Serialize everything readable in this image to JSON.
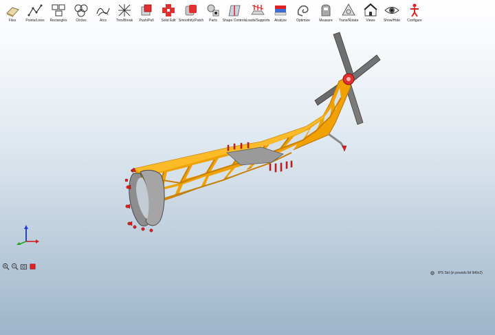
{
  "toolbar": {
    "items": [
      {
        "label": "Files",
        "icon": "files-icon"
      },
      {
        "label": "Points/Lines",
        "icon": "points-lines-icon"
      },
      {
        "label": "Rectangles",
        "icon": "rectangles-icon"
      },
      {
        "label": "Circles",
        "icon": "circles-icon"
      },
      {
        "label": "Arcs",
        "icon": "arcs-icon"
      },
      {
        "label": "Trim/Break",
        "icon": "trim-break-icon"
      },
      {
        "label": "Push/Pull",
        "icon": "push-pull-icon"
      },
      {
        "label": "Solid Edit",
        "icon": "solid-edit-icon"
      },
      {
        "label": "Smoothify/Patch",
        "icon": "smoothify-patch-icon"
      },
      {
        "label": "Parts",
        "icon": "parts-icon"
      },
      {
        "label": "Shape Controls",
        "icon": "shape-controls-icon"
      },
      {
        "label": "Loads/Supports",
        "icon": "loads-supports-icon"
      },
      {
        "label": "Analyze",
        "icon": "analyze-icon"
      },
      {
        "label": "Optimize",
        "icon": "optimize-icon"
      },
      {
        "label": "Measure",
        "icon": "measure-icon"
      },
      {
        "label": "Trans/Rotate",
        "icon": "trans-rotate-icon"
      },
      {
        "label": "Views",
        "icon": "views-icon"
      },
      {
        "label": "Show/Hide",
        "icon": "show-hide-icon"
      },
      {
        "label": "Configure",
        "icon": "configure-icon"
      }
    ]
  },
  "status": {
    "units": "IPS Std (in pounds lbf lbf/in2)"
  },
  "navigation": {
    "icons": [
      "zoom-in-icon",
      "zoom-out-icon",
      "fit-view-icon",
      "record-icon"
    ]
  },
  "colors": {
    "frame": "#f0a000",
    "frame_dark": "#c87800",
    "support": "#e02020",
    "shell": "#8c8c8c",
    "rotor": "#6e6e6e"
  }
}
